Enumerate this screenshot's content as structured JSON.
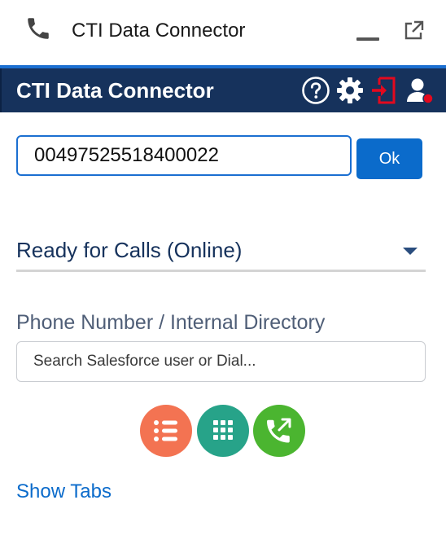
{
  "window": {
    "title": "CTI Data Connector",
    "icons": {
      "phone": "phone-icon",
      "minimize": "minimize-icon",
      "popout": "popout-icon"
    }
  },
  "header": {
    "title": "CTI Data Connector",
    "icons": [
      "help-icon",
      "gear-icon",
      "logout-icon",
      "user-status-icon"
    ],
    "colors": {
      "background": "#16325c",
      "logout": "#e3091e",
      "status_dot": "#e3091e"
    }
  },
  "dialer": {
    "number_value": "00497525518400022",
    "ok_label": "Ok"
  },
  "status": {
    "selected": "Ready for Calls (Online)"
  },
  "directory": {
    "label": "Phone Number / Internal Directory",
    "placeholder": "Search Salesforce user or Dial..."
  },
  "actions": {
    "buttons": [
      {
        "name": "call-list",
        "color": "#f37352",
        "icon": "list-icon"
      },
      {
        "name": "keypad",
        "color": "#27a389",
        "icon": "keypad-icon"
      },
      {
        "name": "call-transfer",
        "color": "#4bb530",
        "icon": "phone-forward-icon"
      }
    ]
  },
  "footer": {
    "show_tabs_label": "Show Tabs"
  },
  "colors": {
    "accent": "#0b6bcb",
    "focus_border": "#1b6fd1"
  }
}
